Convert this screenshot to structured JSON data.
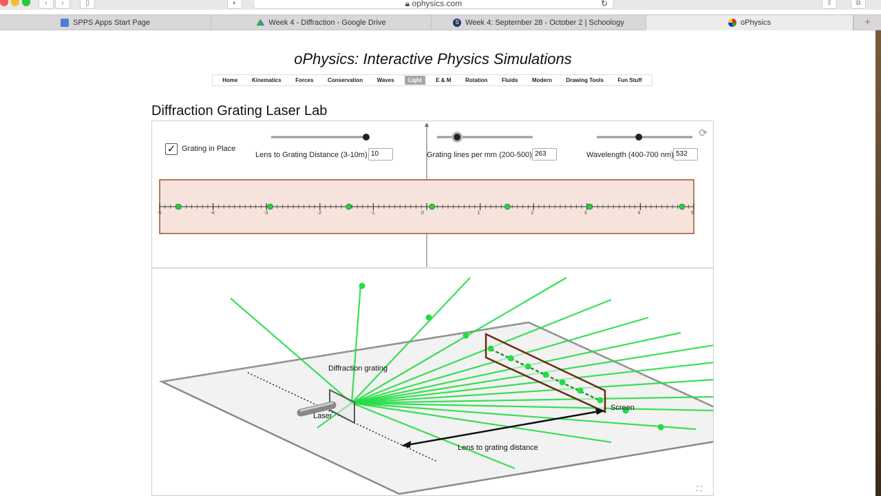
{
  "browser": {
    "url": "ophysics.com",
    "tabs": [
      {
        "label": "SPPS Apps Start Page",
        "icon": "grid-app-icon"
      },
      {
        "label": "Week 4 - Diffraction - Google Drive",
        "icon": "google-drive-icon"
      },
      {
        "label": "Week 4: September 28 - October 2 | Schoology",
        "icon": "schoology-icon"
      },
      {
        "label": "oPhysics",
        "icon": "ophysics-logo-icon",
        "active": true
      }
    ],
    "new_tab_label": "+"
  },
  "site": {
    "title": "oPhysics: Interactive Physics Simulations",
    "nav": [
      "Home",
      "Kinematics",
      "Forces",
      "Conservation",
      "Waves",
      "Light",
      "E & M",
      "Rotation",
      "Fluids",
      "Modern",
      "Drawing Tools",
      "Fun Stuff"
    ],
    "active_nav": "Light"
  },
  "lab": {
    "title": "Diffraction Grating Laser Lab",
    "checkbox_label": "Grating in Place",
    "checkbox_checked": true,
    "lens_label": "Lens to Grating Distance (3-10m)",
    "lens_value": "10",
    "lines_label": "Grating lines per mm (200-500)",
    "lines_value": "263",
    "wavelength_label": "Wavelength (400-700 nm)",
    "wavelength_value": "532",
    "slider_levels": {
      "lens": 1.0,
      "lines": 0.21,
      "wavelength": 0.44
    }
  },
  "ruler": {
    "tick_labels": [
      "-5",
      "-4",
      "-3",
      "-2",
      "-1",
      "0",
      "1",
      "2",
      "3",
      "4",
      "5"
    ],
    "dot_positions": [
      -4.65,
      -2.93,
      -1.46,
      0.1,
      1.51,
      3.05,
      4.78
    ],
    "dot_color": "#2ecc40",
    "band_color": "#f6e3dc",
    "border_color": "#a0522d"
  },
  "scene": {
    "diffraction_label": "Diffraction grating",
    "laser_label": "Laser",
    "screen_label": "Screen",
    "distance_label": "Lens to grating distance",
    "beam_color": "#22dd44",
    "screen_color": "#6b2a10"
  }
}
